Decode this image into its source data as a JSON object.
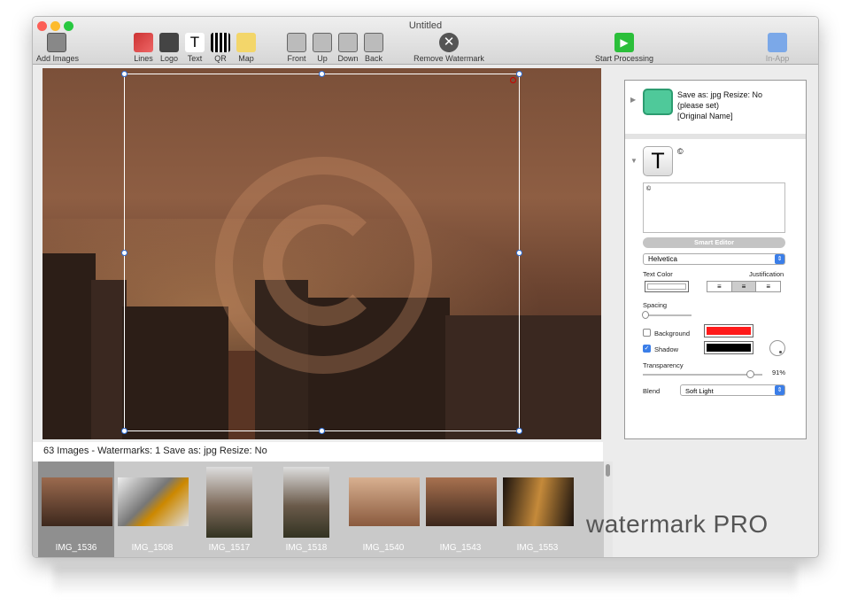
{
  "window": {
    "title": "Untitled"
  },
  "toolbar": {
    "add_images": "Add Images",
    "lines": "Lines",
    "logo": "Logo",
    "text": "Text",
    "qr": "QR",
    "map": "Map",
    "front": "Front",
    "up": "Up",
    "down": "Down",
    "back": "Back",
    "remove_watermark": "Remove Watermark",
    "start_processing": "Start Processing",
    "in_app": "In-App"
  },
  "status": {
    "text": "63 Images   -  Watermarks: 1  Save as: jpg  Resize: No"
  },
  "thumbnails": [
    "IMG_1536",
    "IMG_1508",
    "IMG_1517",
    "IMG_1518",
    "IMG_1540",
    "IMG_1543",
    "IMG_1553"
  ],
  "output": {
    "line1": "Save as: jpg  Resize: No",
    "line2": "(please set)",
    "line3": "[Original Name]"
  },
  "text_watermark": {
    "glyph": "T",
    "symbol": "©",
    "content": "©",
    "smart_editor": "Smart Editor",
    "font": "Helvetica",
    "text_color_label": "Text Color",
    "justification_label": "Justification",
    "spacing_label": "Spacing",
    "background_label": "Background",
    "background_color": "#ff1a1a",
    "shadow_label": "Shadow",
    "shadow_color": "#000000",
    "transparency_label": "Transparency",
    "transparency_value": "91%",
    "blend_label": "Blend",
    "blend_value": "Soft Light",
    "background_checked": false,
    "shadow_checked": true
  },
  "brand": "watermark PRO"
}
